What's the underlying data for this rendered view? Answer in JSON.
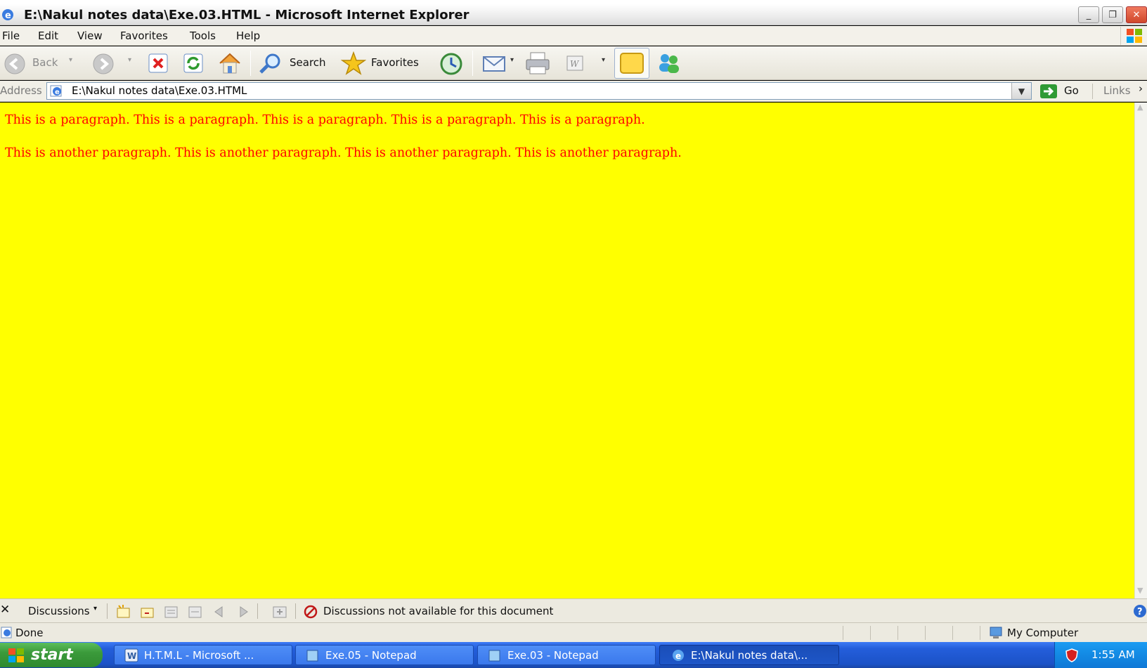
{
  "window": {
    "title": "E:\\Nakul notes data\\Exe.03.HTML - Microsoft Internet Explorer",
    "controls": {
      "minimize": "_",
      "restore": "❐",
      "close": "✕"
    }
  },
  "menu": [
    "File",
    "Edit",
    "View",
    "Favorites",
    "Tools",
    "Help"
  ],
  "toolbar": {
    "back_label": "Back",
    "search_label": "Search",
    "favorites_label": "Favorites"
  },
  "address": {
    "label": "Address",
    "value": "E:\\Nakul notes data\\Exe.03.HTML",
    "go_label": "Go",
    "links_label": "Links"
  },
  "content": {
    "background": "#ffff00",
    "text_color": "#ff0000",
    "paragraphs": [
      "This is a paragraph. This is a paragraph. This is a paragraph. This is a paragraph. This is a paragraph.",
      "This is another paragraph. This is another paragraph. This is another paragraph. This is another paragraph."
    ]
  },
  "discussions": {
    "label": "Discussions",
    "message": "Discussions not available for this document"
  },
  "status": {
    "text": "Done",
    "zone": "My Computer"
  },
  "taskbar": {
    "start_label": "start",
    "tasks": [
      "H.T.M.L - Microsoft ...",
      "Exe.05 - Notepad",
      "Exe.03 - Notepad",
      "E:\\Nakul notes data\\..."
    ],
    "clock": "1:55 AM"
  }
}
